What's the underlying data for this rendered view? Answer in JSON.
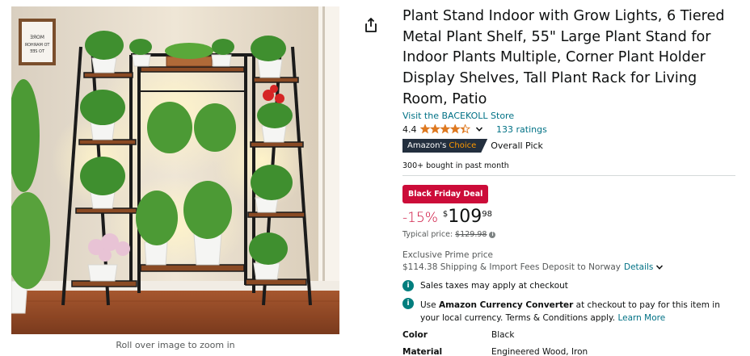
{
  "product": {
    "title": "Plant Stand Indoor with Grow Lights, 6 Tiered Metal Plant Shelf, 55\" Large Plant Stand for Indoor Plants Multiple, Corner Plant Holder Display Shelves, Tall Plant Rack for Living Room, Patio",
    "store_link": "Visit the BACEKOLL Store",
    "rating": "4.4",
    "stars_value": 4.4,
    "ratings_count": "133 ratings",
    "choice_badge_prefix": "Amazon's",
    "choice_badge_accent": "Choice",
    "choice_label": "Overall Pick",
    "bought_text": "300+ bought in past month",
    "deal_badge": "Black Friday Deal",
    "discount": "-15%",
    "price_symbol": "$",
    "price_whole": "109",
    "price_fraction": "98",
    "typical_label": "Typical price:",
    "typical_price": "$129.98",
    "prime_text": "Exclusive Prime price",
    "shipping_text": "$114.38 Shipping & Import Fees Deposit to Norway",
    "shipping_details": "Details",
    "notice_tax": "Sales taxes may apply at checkout",
    "notice_currency_prefix": "Use",
    "notice_currency_bold": "Amazon Currency Converter",
    "notice_currency_rest": "at checkout to pay for this item in your local currency. Terms & Conditions apply.",
    "learn_more": "Learn More",
    "specs": [
      {
        "key": "Color",
        "value": "Black"
      },
      {
        "key": "Material",
        "value": "Engineered Wood, Iron"
      }
    ]
  },
  "image": {
    "zoom_caption": "Roll over image to zoom in",
    "frame_text": "ƎЯOM\nЯOHЯAM OT\nƎƎS OT"
  },
  "colors": {
    "link": "#007185",
    "deal_red": "#cc0c39",
    "star": "#de7921",
    "badge_dark": "#232f3e",
    "badge_accent": "#ff9900",
    "info_teal": "#017e7e"
  },
  "icons": {
    "share": "share-icon",
    "chevron": "chevron-down-icon",
    "info": "info-icon"
  }
}
